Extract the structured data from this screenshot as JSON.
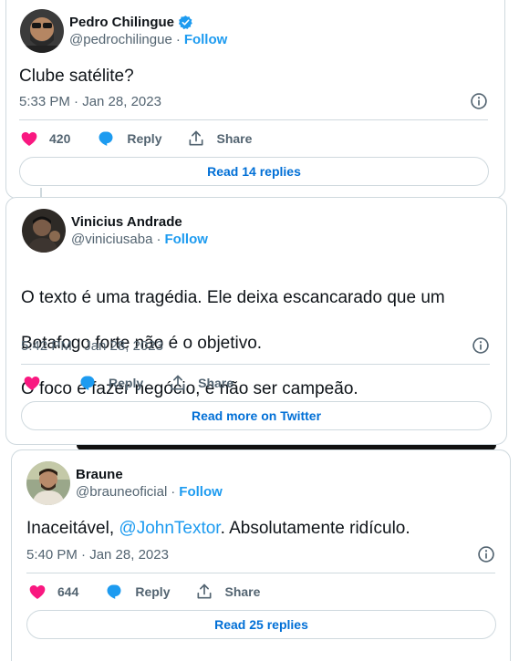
{
  "tweets": [
    {
      "display_name": "Pedro Chilingue",
      "verified": true,
      "handle": "@pedrochilingue",
      "follow_label": "Follow",
      "text": "Clube satélite?",
      "timestamp": "5:33 PM · Jan 28, 2023",
      "like_count": "420",
      "reply_label": "Reply",
      "share_label": "Share",
      "read_label": "Read 14 replies"
    },
    {
      "display_name": "Vinicius Andrade",
      "verified": false,
      "handle": "@viniciusaba",
      "follow_label": "Follow",
      "text_lines": [
        "O texto é uma tragédia. Ele deixa escancarado que um",
        "Botafogo forte não é o objetivo.",
        "O foco é fazer negócio, e não ser campeão."
      ],
      "timestamp": "5:42 PM · Jan 28, 2023",
      "like_count": "",
      "reply_label": "Reply",
      "share_label": "Share",
      "read_label": "Read more on Twitter"
    },
    {
      "display_name": "Braune",
      "verified": false,
      "handle": "@brauneoficial",
      "follow_label": "Follow",
      "text_before": "Inaceitável, ",
      "mention": "@JohnTextor",
      "text_after": ". Absolutamente ridículo.",
      "timestamp": "5:40 PM · Jan 28, 2023",
      "like_count": "644",
      "reply_label": "Reply",
      "share_label": "Share",
      "read_label": "Read 25 replies"
    }
  ],
  "colors": {
    "like": "#f91880",
    "reply": "#1d9bf0",
    "link": "#1d9bf0",
    "read_button": "#006fd6",
    "border": "#cfd9de"
  },
  "icons": [
    "verified-badge-icon",
    "info-icon",
    "heart-icon",
    "reply-bubble-icon",
    "share-icon"
  ]
}
